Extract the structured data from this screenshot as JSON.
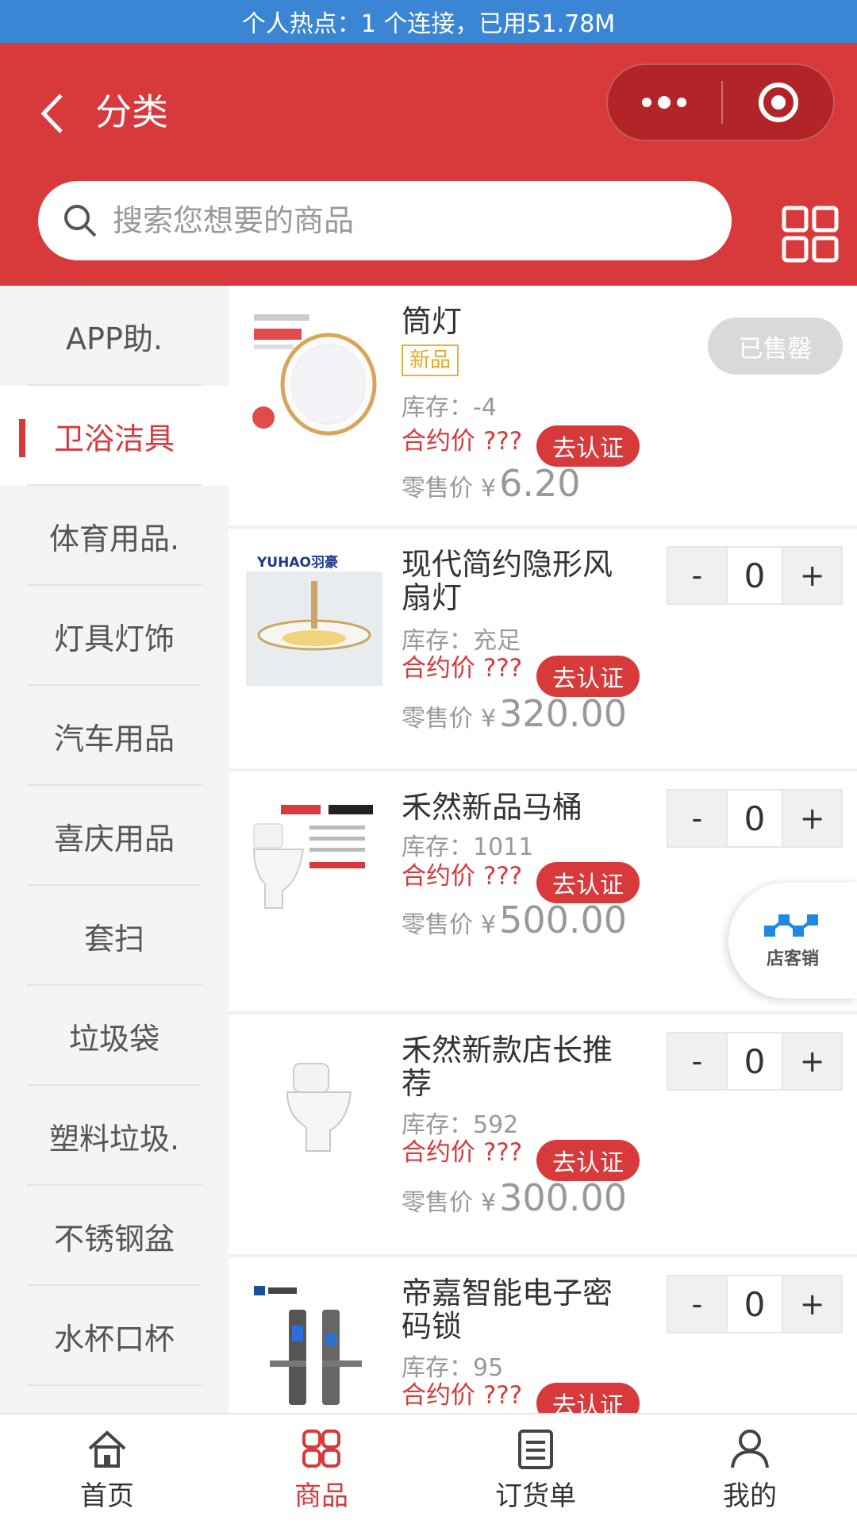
{
  "status_bar": {
    "text": "个人热点：1 个连接，已用51.78M"
  },
  "header": {
    "title": "分类",
    "search_placeholder": "搜索您想要的商品"
  },
  "colors": {
    "brand": "#d8393b",
    "status_bar": "#3a86d4",
    "new_tag": "#e8b23a"
  },
  "sidebar": {
    "active_index": 1,
    "items": [
      {
        "label": "APP助."
      },
      {
        "label": "卫浴洁具"
      },
      {
        "label": "体育用品."
      },
      {
        "label": "灯具灯饰"
      },
      {
        "label": "汽车用品"
      },
      {
        "label": "喜庆用品"
      },
      {
        "label": "套扫"
      },
      {
        "label": "垃圾袋"
      },
      {
        "label": "塑料垃圾."
      },
      {
        "label": "不锈钢盆"
      },
      {
        "label": "水杯口杯"
      }
    ]
  },
  "products": [
    {
      "name": "筒灯",
      "tag": "新品",
      "stock": "库存：-4",
      "contract": "合约价 ???",
      "certify": "去认证",
      "retail_label": "零售价",
      "currency": "¥",
      "price": "6.20",
      "sold_out": "已售罄"
    },
    {
      "name": "现代简约隐形风扇灯",
      "stock": "库存：充足",
      "contract": "合约价 ???",
      "certify": "去认证",
      "retail_label": "零售价",
      "currency": "¥",
      "price": "320.00",
      "qty": "0",
      "thumb_text": "YUHAO羽豪"
    },
    {
      "name": "禾然新品马桶",
      "stock": "库存：1011",
      "contract": "合约价 ???",
      "certify": "去认证",
      "retail_label": "零售价",
      "currency": "¥",
      "price": "500.00",
      "qty": "0"
    },
    {
      "name": "禾然新款店长推荐",
      "stock": "库存：592",
      "contract": "合约价 ???",
      "certify": "去认证",
      "retail_label": "零售价",
      "currency": "¥",
      "price": "300.00",
      "qty": "0"
    },
    {
      "name": "帝嘉智能电子密码锁",
      "stock": "库存：95",
      "contract": "合约价 ???",
      "certify": "去认证",
      "qty": "0"
    }
  ],
  "stepper": {
    "minus": "-",
    "plus": "+"
  },
  "float_badge": {
    "label": "店客销"
  },
  "tabbar": {
    "active_index": 1,
    "items": [
      {
        "label": "首页",
        "icon": "home-icon"
      },
      {
        "label": "商品",
        "icon": "goods-icon"
      },
      {
        "label": "订货单",
        "icon": "order-icon"
      },
      {
        "label": "我的",
        "icon": "user-icon"
      }
    ]
  }
}
